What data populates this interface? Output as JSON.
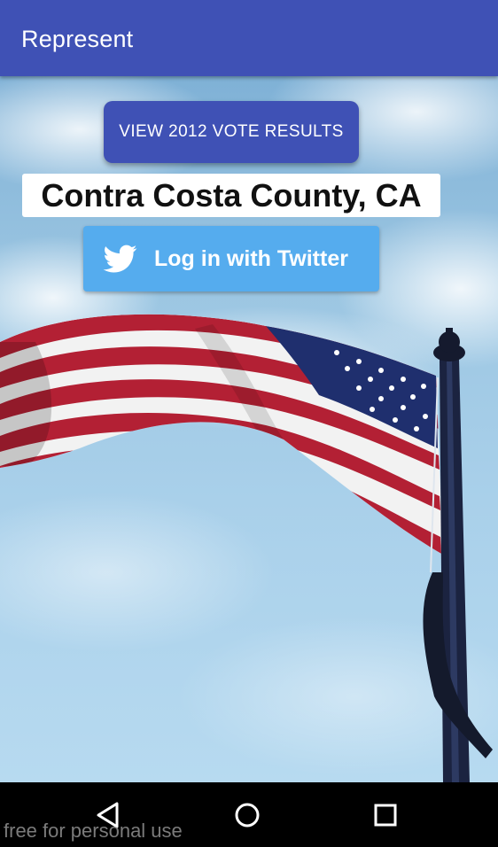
{
  "app": {
    "title": "Represent"
  },
  "main": {
    "vote_results_label": "VIEW 2012 VOTE RESULTS",
    "county_label": "Contra Costa County, CA",
    "twitter_login_label": "Log in with Twitter"
  },
  "navbar": {
    "back_icon": "back-triangle-icon",
    "home_icon": "home-circle-icon",
    "recent_icon": "recent-apps-square-icon",
    "watermark": "free for personal use"
  },
  "colors": {
    "primary": "#3F51B5",
    "twitter": "#55ACEE",
    "sky": "#9cc6e2"
  }
}
